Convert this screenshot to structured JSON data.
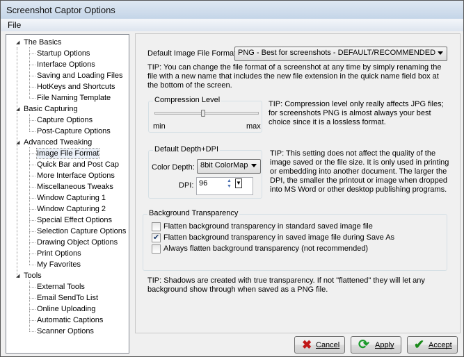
{
  "window": {
    "title": "Screenshot Captor Options"
  },
  "menu": {
    "file": "File"
  },
  "tree": [
    {
      "label": "The Basics",
      "level": 0
    },
    {
      "label": "Startup Options",
      "level": 1
    },
    {
      "label": "Interface Options",
      "level": 1
    },
    {
      "label": "Saving and Loading Files",
      "level": 1
    },
    {
      "label": "HotKeys and Shortcuts",
      "level": 1
    },
    {
      "label": "File Naming Template",
      "level": 1
    },
    {
      "label": "Basic Capturing",
      "level": 0
    },
    {
      "label": "Capture Options",
      "level": 1
    },
    {
      "label": "Post-Capture Options",
      "level": 1
    },
    {
      "label": "Advanced Tweaking",
      "level": 0
    },
    {
      "label": "Image File Format",
      "level": 1,
      "selected": true
    },
    {
      "label": "Quick Bar and Post Cap",
      "level": 1
    },
    {
      "label": "More Interface Options",
      "level": 1
    },
    {
      "label": "Miscellaneous Tweaks",
      "level": 1
    },
    {
      "label": "Window Capturing 1",
      "level": 1
    },
    {
      "label": "Window Capturing 2",
      "level": 1
    },
    {
      "label": "Special Effect Options",
      "level": 1
    },
    {
      "label": "Selection Capture Options",
      "level": 1
    },
    {
      "label": "Drawing Object Options",
      "level": 1
    },
    {
      "label": "Print Options",
      "level": 1
    },
    {
      "label": "My Favorites",
      "level": 1
    },
    {
      "label": "Tools",
      "level": 0
    },
    {
      "label": "External Tools",
      "level": 1
    },
    {
      "label": "Email SendTo List",
      "level": 1
    },
    {
      "label": "Online Uploading",
      "level": 1
    },
    {
      "label": "Automatic Captions",
      "level": 1
    },
    {
      "label": "Scanner Options",
      "level": 1
    }
  ],
  "format": {
    "label": "Default Image File Format:",
    "value": "PNG - Best for screenshots - DEFAULT/RECOMMENDED",
    "tip": "TIP: You can change the file format of a screenshot at any time by simply renaming the file with a new name that includes the new file extension in the quick name field box at the bottom of the screen."
  },
  "compression": {
    "title": "Compression Level",
    "min": "min",
    "max": "max",
    "level": 0.45,
    "tip": "TIP: Compression level only really affects JPG files; for screenshots PNG is almost always your best choice since it is a lossless format."
  },
  "depth": {
    "title": "Default Depth+DPI",
    "color_label": "Color Depth:",
    "color_value": "8bit ColorMap",
    "dpi_label": "DPI:",
    "dpi_value": "96",
    "tip": "TIP:  This setting does not affect the quality of the image saved or the file size.  It is only used in printing or embedding into another document.  The larger the DPI, the smaller the printout or image when dropped into MS Word or other desktop publishing programs."
  },
  "transparency": {
    "title": "Background Transparency",
    "options": [
      {
        "label": "Flatten background transparency in standard saved image file",
        "checked": false
      },
      {
        "label": "Flatten background transparency in saved image file during Save As",
        "checked": true
      },
      {
        "label": "Always flatten background transparency (not recommended)",
        "checked": false
      }
    ]
  },
  "shadow_tip": "TIP: Shadows are created with true transparency.  If not \"flattened\" they will let any background show through when saved as a PNG file.",
  "buttons": {
    "cancel": "Cancel",
    "apply": "Apply",
    "accept": "Accept"
  }
}
